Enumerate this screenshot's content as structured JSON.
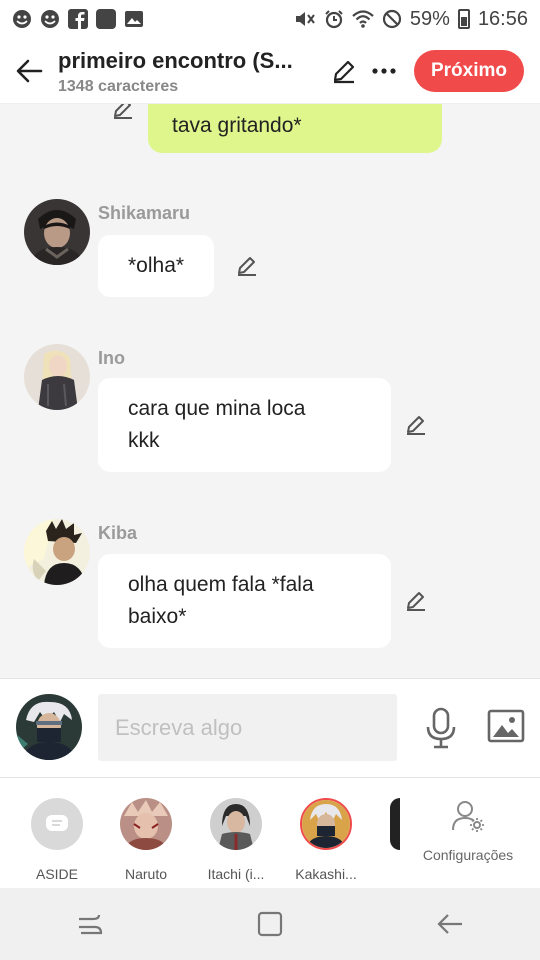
{
  "status_bar": {
    "battery": "59%",
    "time": "16:56",
    "app_icons": [
      "smiley-icon",
      "smiley-icon",
      "facebook-icon",
      "square-icon",
      "image-icon"
    ],
    "system_icons": [
      "mute-icon",
      "alarm-icon",
      "wifi-icon",
      "dnd-icon",
      "battery-icon"
    ]
  },
  "header": {
    "title": "primeiro encontro (S...",
    "subtitle": "1348 caracteres",
    "next_label": "Próximo",
    "accent": "#f14a4a"
  },
  "self_message": {
    "text": "tava gritando*",
    "color": "#dff68d"
  },
  "messages": [
    {
      "sender": "Shikamaru",
      "lines": "*olha*"
    },
    {
      "sender": "Ino",
      "lines": "cara que mina loca\nkkk"
    },
    {
      "sender": "Kiba",
      "lines": "olha quem fala *fala\nbaixo*"
    }
  ],
  "composer": {
    "placeholder": "Escreva algo"
  },
  "characters": [
    {
      "label": "ASIDE"
    },
    {
      "label": "Naruto"
    },
    {
      "label": "Itachi (i..."
    },
    {
      "label": "Kakashi..."
    }
  ],
  "settings_label": "Configurações"
}
